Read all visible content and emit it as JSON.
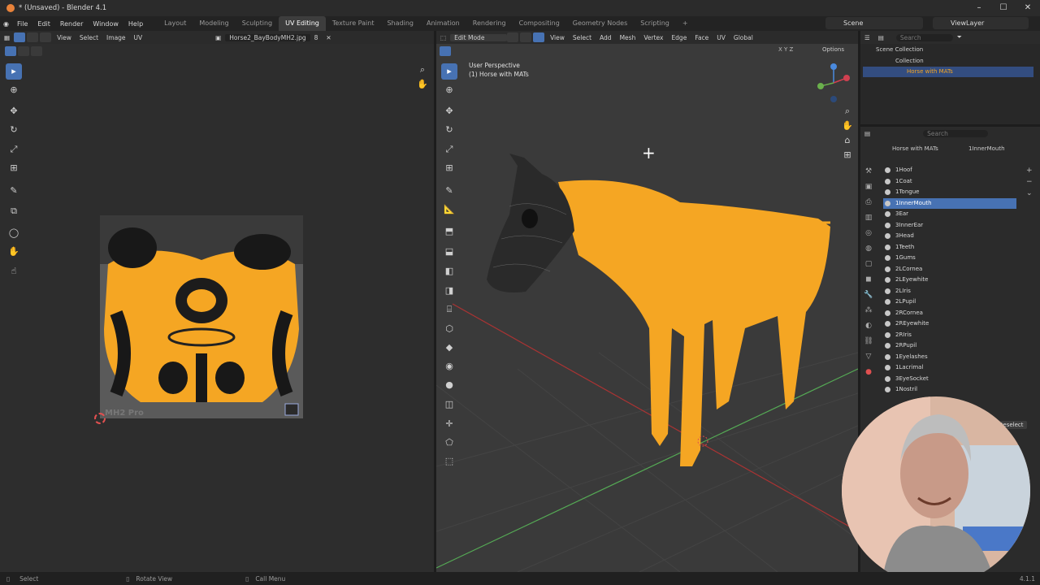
{
  "window": {
    "title": "* (Unsaved) - Blender 4.1"
  },
  "menu": [
    "File",
    "Edit",
    "Render",
    "Window",
    "Help"
  ],
  "workspaces": [
    "Layout",
    "Modeling",
    "Sculpting",
    "UV Editing",
    "Texture Paint",
    "Shading",
    "Animation",
    "Rendering",
    "Compositing",
    "Geometry Nodes",
    "Scripting"
  ],
  "active_workspace": "UV Editing",
  "scene": "Scene",
  "view_layer": "ViewLayer",
  "uv_editor": {
    "menus": [
      "View",
      "Select",
      "Image",
      "UV"
    ],
    "image_name": "Horse2_BayBodyMH2.jpg",
    "image_users": "8",
    "watermark": "MH2 Pro"
  },
  "viewport": {
    "mode": "Edit Mode",
    "menus": [
      "View",
      "Select",
      "Add",
      "Mesh",
      "Vertex",
      "Edge",
      "Face",
      "UV"
    ],
    "transform": "Global",
    "perspective": "User Perspective",
    "object_label": "(1) Horse with MATs",
    "options": "Options",
    "axes": [
      "X",
      "Y",
      "Z"
    ]
  },
  "outliner": {
    "search_placeholder": "Search",
    "scene_collection": "Scene Collection",
    "collection": "Collection",
    "object": "Horse with MATs"
  },
  "properties": {
    "search_placeholder": "Search",
    "object": "Horse with MATs",
    "material": "1InnerMouth",
    "materials": [
      "1Hoof",
      "1Coat",
      "1Tongue",
      "1InnerMouth",
      "3Ear",
      "3InnerEar",
      "3Head",
      "1Teeth",
      "1Gums",
      "2LCornea",
      "2LEyewhite",
      "2LIris",
      "2LPupil",
      "2RCornea",
      "2REyewhite",
      "2RIris",
      "2RPupil",
      "1Eyelashes",
      "1Lacrimal",
      "3EyeSocket",
      "1Nostril"
    ],
    "selected_index": 3,
    "deselect": "Deselect"
  },
  "status": {
    "left": "Select",
    "middle": "Rotate View",
    "right": "Call Menu",
    "version": "4.1.1"
  },
  "colors": {
    "accent": "#4772b3",
    "selection": "#f5a623",
    "brand": "#e8823a"
  }
}
